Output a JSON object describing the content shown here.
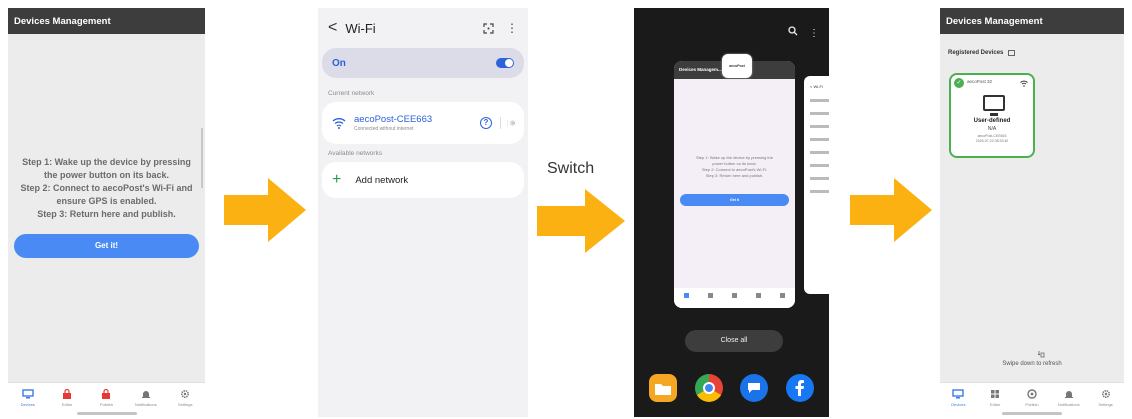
{
  "colors": {
    "arrow": "#fbb111",
    "accent": "#4a8af4",
    "wifi_blue": "#2d62d8",
    "green": "#4caf50"
  },
  "phone1": {
    "title": "Devices Management",
    "steps": [
      "Step 1: Wake up the device by pressing",
      "the power button on its back.",
      "Step 2: Connect to aecoPost's Wi-Fi and",
      "ensure GPS is enabled.",
      "Step 3: Return here and publish."
    ],
    "button": "Get it!",
    "nav": [
      {
        "label": "Devices",
        "icon": "devices-icon"
      },
      {
        "label": "Editor",
        "icon": "lock-icon"
      },
      {
        "label": "Publish",
        "icon": "lock-icon"
      },
      {
        "label": "Notifications",
        "icon": "bell-icon"
      },
      {
        "label": "Settings",
        "icon": "gear-icon"
      }
    ]
  },
  "phone2": {
    "back": "<",
    "title": "Wi-Fi",
    "qr": "QR",
    "more": "⋮",
    "toggle_label": "On",
    "current_network_label": "Current network",
    "network": {
      "name": "aecoPost-CEE663",
      "status": "Connected without internet"
    },
    "available_networks_label": "Available networks",
    "add_network": "Add network"
  },
  "switch_label": "Switch",
  "phone3": {
    "recent_app_title": "Devices Managem...",
    "app_badge": "aecoPost",
    "mini_steps": [
      "Step 1: Wake up the device by pressing the",
      "power button on its back.",
      "Step 2: Connect to aecoPost's Wi-Fi.",
      "Step 3: Return here and publish."
    ],
    "mini_button": "Get it",
    "side_title": "< Wi-Fi",
    "close_all": "Close all",
    "search_icon": "search-icon",
    "more": "⋮"
  },
  "phone4": {
    "title": "Devices Management",
    "registered_label": "Registered Devices",
    "device": {
      "name": "aecoPost 32",
      "type": "User-defined",
      "na": "N/A",
      "ssid": "aecoPost-CEE663",
      "date": "2025-07-22 08:33:40"
    },
    "swipe_hint": "Swipe down to refresh",
    "nav": [
      {
        "label": "Devices",
        "icon": "devices-icon"
      },
      {
        "label": "Editor",
        "icon": "grid-icon"
      },
      {
        "label": "Publish",
        "icon": "publish-icon"
      },
      {
        "label": "Notifications",
        "icon": "bell-icon"
      },
      {
        "label": "Settings",
        "icon": "gear-icon"
      }
    ]
  }
}
